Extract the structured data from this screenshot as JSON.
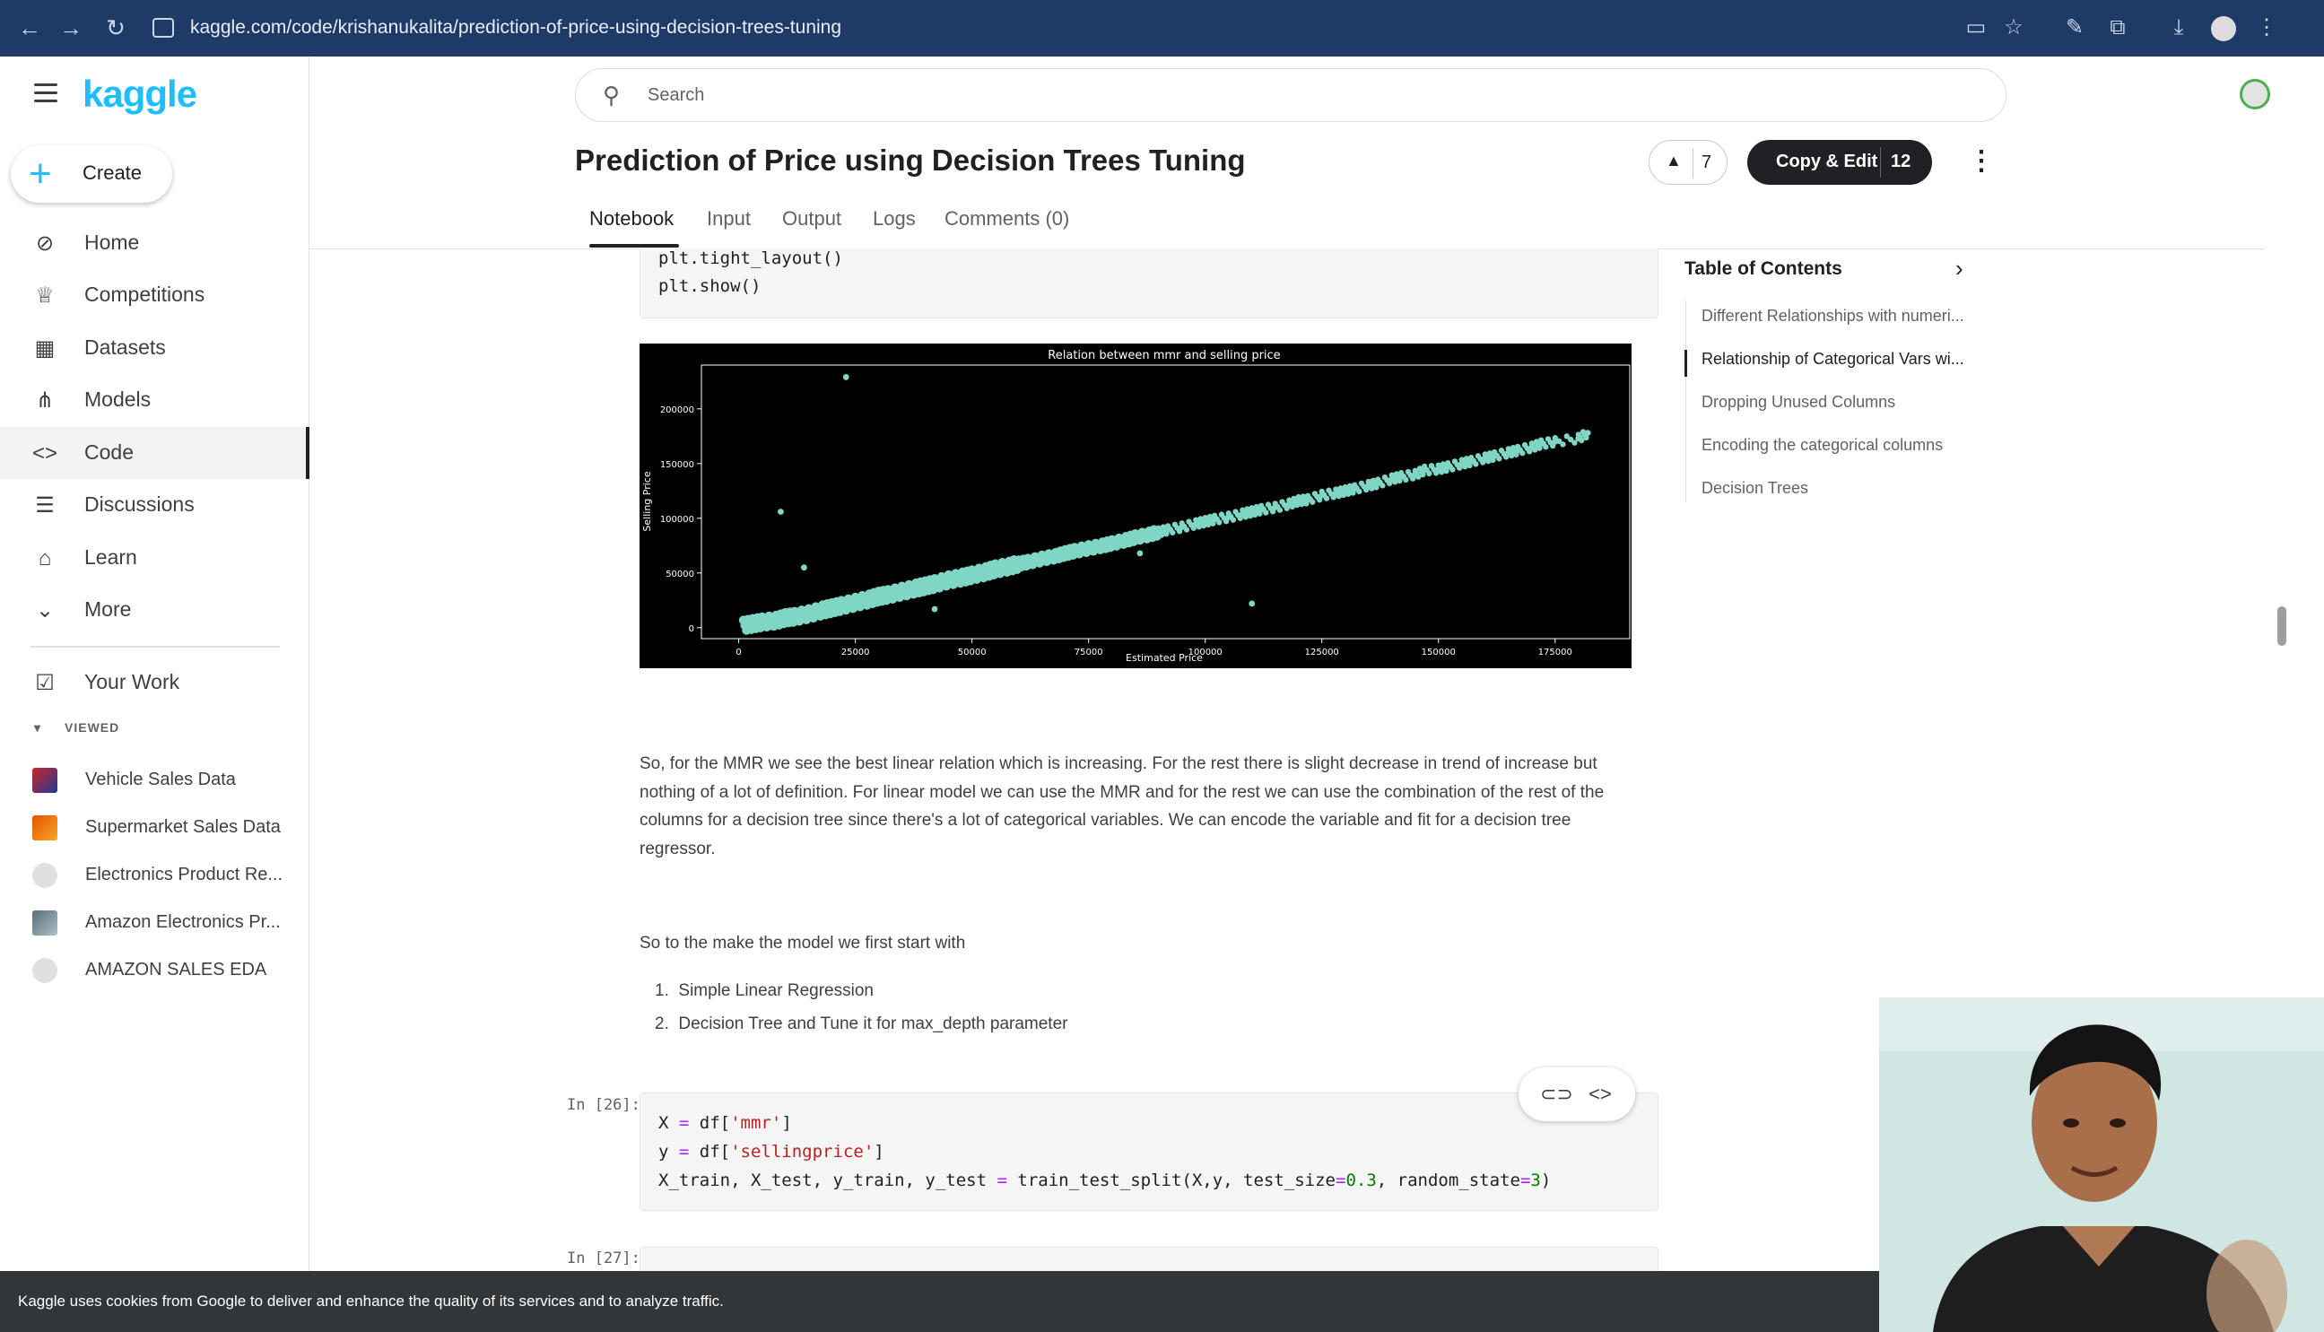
{
  "browser": {
    "url": "kaggle.com/code/krishanukalita/prediction-of-price-using-decision-trees-tuning"
  },
  "sidebar": {
    "logo": "kaggle",
    "create_label": "Create",
    "items": [
      {
        "label": "Home",
        "icon": "compass-icon"
      },
      {
        "label": "Competitions",
        "icon": "trophy-icon"
      },
      {
        "label": "Datasets",
        "icon": "table-icon"
      },
      {
        "label": "Models",
        "icon": "models-icon"
      },
      {
        "label": "Code",
        "icon": "code-icon",
        "active": true
      },
      {
        "label": "Discussions",
        "icon": "discussion-icon"
      },
      {
        "label": "Learn",
        "icon": "school-icon"
      },
      {
        "label": "More",
        "icon": "chevron-down-icon"
      }
    ],
    "your_work": "Your Work",
    "viewed_header": "VIEWED",
    "recent": [
      {
        "label": "Vehicle Sales Data"
      },
      {
        "label": "Supermarket Sales Data"
      },
      {
        "label": "Electronics Product Re..."
      },
      {
        "label": "Amazon Electronics Pr..."
      },
      {
        "label": "AMAZON SALES EDA"
      }
    ]
  },
  "search": {
    "placeholder": "Search"
  },
  "header": {
    "title": "Prediction of Price using Decision Trees Tuning",
    "votes": "7",
    "copy_edit_label": "Copy & Edit",
    "copy_edit_count": "12"
  },
  "tabs": [
    "Notebook",
    "Input",
    "Output",
    "Logs",
    "Comments (0)"
  ],
  "cells": {
    "prev_code": [
      "plt.tight_layout()",
      "plt.show()"
    ],
    "md_para": "So, for the MMR we see the best linear relation which is increasing. For the rest there is slight decrease in trend of increase but nothing of a lot of definition. For linear model we can use the MMR and for the rest we can use the combination of the rest of the columns for a decision tree since there's a lot of categorical variables. We can encode the variable and fit for a decision tree regressor.",
    "md_intro": "So to the make the model we first start with",
    "md_list": [
      "Simple Linear Regression",
      "Decision Tree and Tune it for max_depth parameter"
    ],
    "prompt_26": "In [26]:",
    "prompt_27": "In [27]:"
  },
  "toc": {
    "title": "Table of Contents",
    "items": [
      "Different Relationships with numeri...",
      "Relationship of Categorical Vars wi...",
      "Dropping Unused Columns",
      "Encoding the categorical columns",
      "Decision Trees"
    ],
    "active_index": 1
  },
  "cookie_text": "Kaggle uses cookies from Google to deliver and enhance the quality of its services and to analyze traffic.",
  "chart_data": {
    "type": "scatter",
    "title": "Relation between mmr and selling price",
    "xlabel": "Estimated Price",
    "ylabel": "Selling Price",
    "xlim": [
      -8000,
      191000
    ],
    "ylim": [
      -10000,
      240000
    ],
    "xticks": [
      "0",
      "25000",
      "50000",
      "75000",
      "100000",
      "125000",
      "150000",
      "175000"
    ],
    "yticks": [
      "0",
      "50000",
      "100000",
      "150000",
      "200000"
    ],
    "background": "#000000",
    "point_color": "#7fd6c4",
    "series": [
      {
        "points": [
          [
            1000,
            2000
          ],
          [
            3000,
            3500
          ],
          [
            5000,
            5000
          ],
          [
            8000,
            6500
          ],
          [
            10000,
            9000
          ],
          [
            12000,
            10000
          ],
          [
            15000,
            12500
          ],
          [
            18000,
            16000
          ],
          [
            20000,
            18000
          ],
          [
            22000,
            20000
          ],
          [
            25000,
            23000
          ],
          [
            28000,
            26000
          ],
          [
            30000,
            28500
          ],
          [
            32000,
            30000
          ],
          [
            35000,
            33000
          ],
          [
            38000,
            36000
          ],
          [
            40000,
            38000
          ],
          [
            42000,
            40000
          ],
          [
            45000,
            43500
          ],
          [
            48000,
            46000
          ],
          [
            50000,
            48000
          ],
          [
            53000,
            51000
          ],
          [
            55000,
            53500
          ],
          [
            58000,
            56000
          ],
          [
            60000,
            58500
          ],
          [
            62000,
            60000
          ],
          [
            65000,
            63000
          ],
          [
            68000,
            65500
          ],
          [
            70000,
            68000
          ],
          [
            72000,
            70000
          ],
          [
            75000,
            72500
          ],
          [
            78000,
            75000
          ],
          [
            80000,
            77000
          ],
          [
            83000,
            80000
          ],
          [
            85000,
            82500
          ],
          [
            88000,
            85000
          ],
          [
            90000,
            87500
          ],
          [
            92000,
            89500
          ],
          [
            95000,
            92000
          ],
          [
            98000,
            95000
          ],
          [
            100000,
            97000
          ],
          [
            102000,
            99000
          ],
          [
            105000,
            101000
          ],
          [
            108000,
            104000
          ],
          [
            110000,
            106000
          ],
          [
            112000,
            108000
          ],
          [
            115000,
            110000
          ],
          [
            118000,
            113000
          ],
          [
            120000,
            116000
          ],
          [
            122000,
            117000
          ],
          [
            125000,
            121000
          ],
          [
            128000,
            123000
          ],
          [
            130000,
            125000
          ],
          [
            132000,
            127000
          ],
          [
            135000,
            130000
          ],
          [
            137000,
            132000
          ],
          [
            140000,
            136000
          ],
          [
            142000,
            138000
          ],
          [
            145000,
            140000
          ],
          [
            147000,
            144000
          ],
          [
            150000,
            145000
          ],
          [
            152000,
            147000
          ],
          [
            155000,
            150000
          ],
          [
            157000,
            152000
          ],
          [
            160000,
            155000
          ],
          [
            162000,
            157000
          ],
          [
            165000,
            160000
          ],
          [
            167000,
            162000
          ],
          [
            170000,
            165000
          ],
          [
            172000,
            168000
          ],
          [
            175000,
            170000
          ],
          [
            180000,
            173000
          ],
          [
            182000,
            178000
          ]
        ]
      }
    ],
    "outliers": [
      [
        23000,
        229000
      ],
      [
        9000,
        106000
      ],
      [
        110000,
        22000
      ],
      [
        14000,
        55000
      ],
      [
        42000,
        17000
      ],
      [
        86000,
        68000
      ]
    ]
  }
}
